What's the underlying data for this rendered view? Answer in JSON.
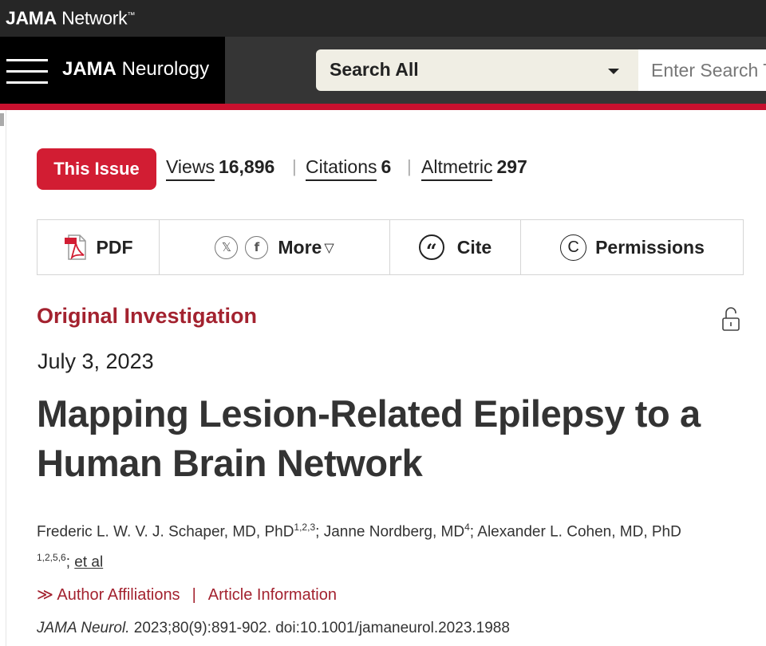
{
  "network": {
    "brand_bold": "JAMA",
    "brand_rest": " Network",
    "tm": "™"
  },
  "journal": {
    "brand_bold": "JAMA",
    "brand_rest": " Neurology"
  },
  "search": {
    "scope": "Search All",
    "placeholder": "Enter Search Term"
  },
  "metrics": {
    "this_issue": "This Issue",
    "views_label": "Views",
    "views_value": "16,896",
    "citations_label": "Citations",
    "citations_value": "6",
    "altmetric_label": "Altmetric",
    "altmetric_value": "297",
    "separator": "|"
  },
  "toolbar": {
    "pdf": "PDF",
    "x_glyph": "𝕏",
    "facebook_glyph": "f",
    "more": "More",
    "more_caret": "▽",
    "cite_glyph": "“",
    "cite": "Cite",
    "permissions_glyph": "C",
    "permissions": "Permissions"
  },
  "article": {
    "type": "Original Investigation",
    "date": "July 3, 2023",
    "title": "Mapping Lesion-Related Epilepsy to a Human Brain Network",
    "authors": [
      {
        "name": "Frederic L. W. V. J. Schaper, MD, PhD",
        "sup": "1,2,3"
      },
      {
        "name": "Janne Nordberg, MD",
        "sup": "4"
      },
      {
        "name": "Alexander L. Cohen, MD, PhD",
        "sup": "1,2,5,6"
      }
    ],
    "author_sep": "; ",
    "et_al": "et al",
    "affiliations_arrow": "≫",
    "affiliations": "Author Affiliations",
    "links_sep": "|",
    "article_info": "Article Information",
    "journal_abbrev": "JAMA Neurol.",
    "citation": " 2023;80(9):891-902. doi:10.1001/jamaneurol.2023.1988"
  },
  "colors": {
    "brand_red": "#d21d33",
    "heading_red": "#a3222f",
    "header_dark": "#262626"
  }
}
